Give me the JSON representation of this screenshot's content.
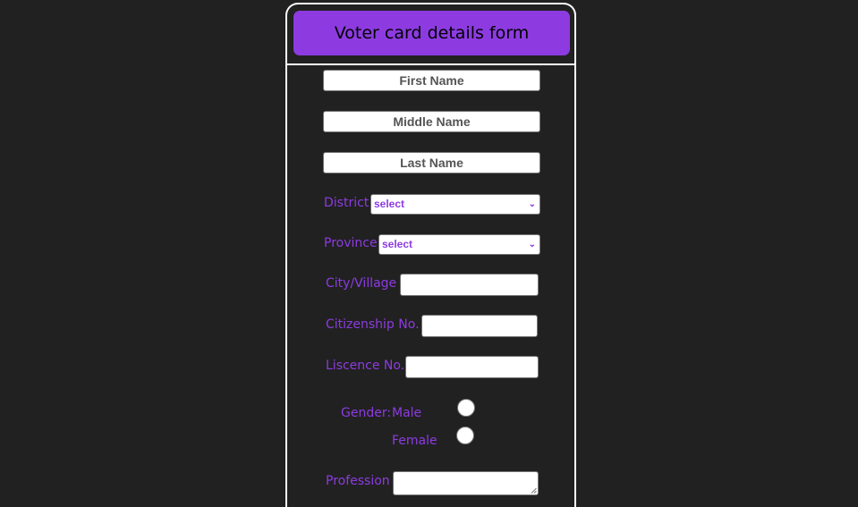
{
  "form": {
    "title": "Voter card details form",
    "first_name_placeholder": "First Name",
    "middle_name_placeholder": "Middle Name",
    "last_name_placeholder": "Last Name",
    "district_label": "District",
    "district_selected": "select",
    "province_label": "Province",
    "province_selected": "select",
    "city_label": "City/Village",
    "citizenship_label": "Citizenship No.",
    "licence_label": "Liscence No.",
    "gender_label": "Gender:",
    "male_label": "Male",
    "female_label": "Female",
    "profession_label": "Profession"
  },
  "colors": {
    "background": "#212121",
    "accent": "#8d3be1",
    "border": "#ffffff"
  }
}
